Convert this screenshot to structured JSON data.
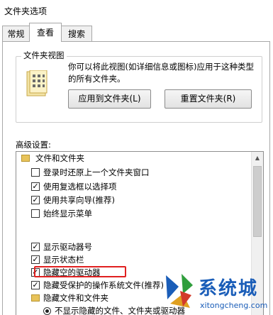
{
  "window": {
    "title": "文件夹选项"
  },
  "tabs": [
    {
      "label": "常规"
    },
    {
      "label": "查看"
    },
    {
      "label": "搜索"
    }
  ],
  "folder_views": {
    "legend": "文件夹视图",
    "description": "你可以将此视图(如详细信息或图标)应用于这种类型的所有文件夹。",
    "apply_button": "应用到文件夹(L)",
    "reset_button": "重置文件夹(R)"
  },
  "advanced": {
    "label": "高级设置:",
    "items": [
      {
        "type": "folder",
        "label": "文件和文件夹"
      },
      {
        "type": "checkbox",
        "label": "登录时还原上一个文件夹窗口",
        "checked": false
      },
      {
        "type": "checkbox",
        "label": "使用复选框以选择项",
        "checked": true
      },
      {
        "type": "checkbox",
        "label": "使用共享向导(推荐)",
        "checked": true
      },
      {
        "type": "checkbox",
        "label": "始终显示菜单",
        "checked": false
      },
      {
        "type": "checkbox",
        "label": "显示驱动器号",
        "checked": true
      },
      {
        "type": "checkbox",
        "label": "显示状态栏",
        "checked": true
      },
      {
        "type": "checkbox",
        "label": "隐藏空的驱动器",
        "checked": true
      },
      {
        "type": "checkbox",
        "label": "隐藏受保护的操作系统文件(推荐)",
        "checked": true
      },
      {
        "type": "folder",
        "label": "隐藏文件和文件夹"
      },
      {
        "type": "radio",
        "label": "不显示隐藏的文件、文件夹或驱动器",
        "checked": true
      }
    ]
  },
  "watermark": {
    "title": "系统城",
    "url": "xitongcheng.com"
  },
  "colors": {
    "highlight": "#e02020",
    "watermark": "#1a5db8"
  }
}
